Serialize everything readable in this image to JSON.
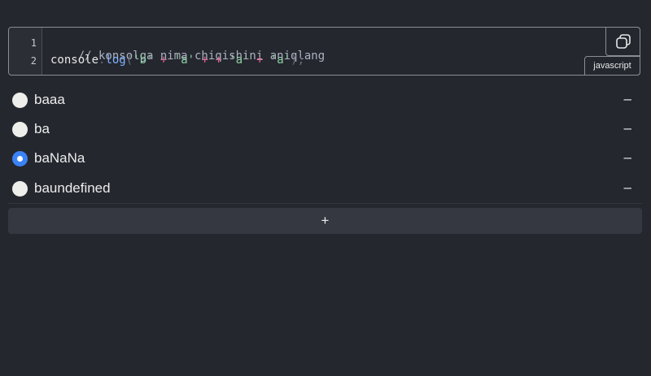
{
  "code": {
    "language": "javascript",
    "line_numbers": [
      "1",
      "2"
    ],
    "line1_comment": "// konsolga nima chiqishini aniqlang",
    "line2": {
      "obj": "console",
      "dot": ".",
      "fn": "log",
      "open": "(",
      "s1": "'b'",
      "op1": "+",
      "s2": "'a'",
      "op2": "+ +",
      "s3": "'a'",
      "op3": "+",
      "s4": "'a'",
      "close": ");"
    },
    "copy_icon": "copy-icon"
  },
  "options": [
    {
      "label": "baaa",
      "checked": false,
      "remove": "–"
    },
    {
      "label": "ba",
      "checked": false,
      "remove": "–"
    },
    {
      "label": "baNaNa",
      "checked": true,
      "remove": "–"
    },
    {
      "label": "baundefined",
      "checked": false,
      "remove": "–"
    }
  ],
  "add_button": {
    "label": "+"
  },
  "colors": {
    "background": "#24272e",
    "accent": "#3b82f6",
    "string": "#8fcfa2",
    "operator": "#e06c9a",
    "function": "#82b1ff"
  }
}
